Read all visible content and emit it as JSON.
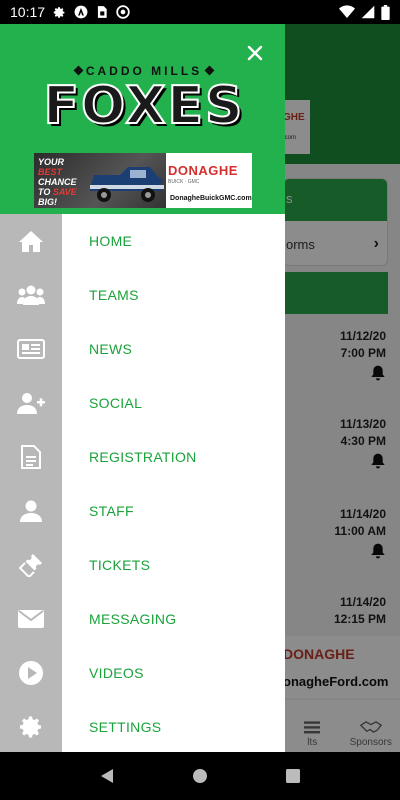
{
  "status_bar": {
    "time": "10:17"
  },
  "drawer": {
    "logo": {
      "top_text": "CADDO MILLS",
      "main_text": "FOXES"
    },
    "ad": {
      "slogan_line1": "YOUR",
      "slogan_line2": "BEST",
      "slogan_line3": "CHANCE",
      "slogan_line4_a": "TO ",
      "slogan_line4_b": "SAVE",
      "slogan_line5": "BIG!",
      "brand": "DONAGHE",
      "sub": "BUICK · GMC",
      "url": "DonagheBuickGMC.com"
    },
    "menu": [
      {
        "label": "HOME",
        "icon": "home-icon"
      },
      {
        "label": "TEAMS",
        "icon": "teams-icon"
      },
      {
        "label": "NEWS",
        "icon": "news-icon"
      },
      {
        "label": "SOCIAL",
        "icon": "add-user-icon"
      },
      {
        "label": "REGISTRATION",
        "icon": "document-icon"
      },
      {
        "label": "STAFF",
        "icon": "person-icon"
      },
      {
        "label": "TICKETS",
        "icon": "ticket-icon"
      },
      {
        "label": "MESSAGING",
        "icon": "envelope-icon"
      },
      {
        "label": "VIDEOS",
        "icon": "play-icon"
      },
      {
        "label": "SETTINGS",
        "icon": "gear-icon"
      }
    ]
  },
  "background": {
    "ad_top": {
      "brand": "GHE",
      "url": ".com"
    },
    "card": {
      "header": "s",
      "row_label": "orms"
    },
    "games": [
      {
        "date": "11/12/20",
        "time": "7:00 PM"
      },
      {
        "date": "11/13/20",
        "time": "4:30 PM"
      },
      {
        "date": "11/14/20",
        "time": "11:00 AM"
      },
      {
        "date": "11/14/20",
        "time": "12:15 PM"
      }
    ],
    "ad_bottom": {
      "brand": "DONAGHE",
      "url": "onagheFord.com"
    },
    "tabs": [
      {
        "label": "lts"
      },
      {
        "label": "Sponsors"
      }
    ]
  },
  "colors": {
    "header_green": "#22b14c",
    "menu_text_green": "#1aa33a",
    "rail_gray": "#b8b8b8"
  }
}
